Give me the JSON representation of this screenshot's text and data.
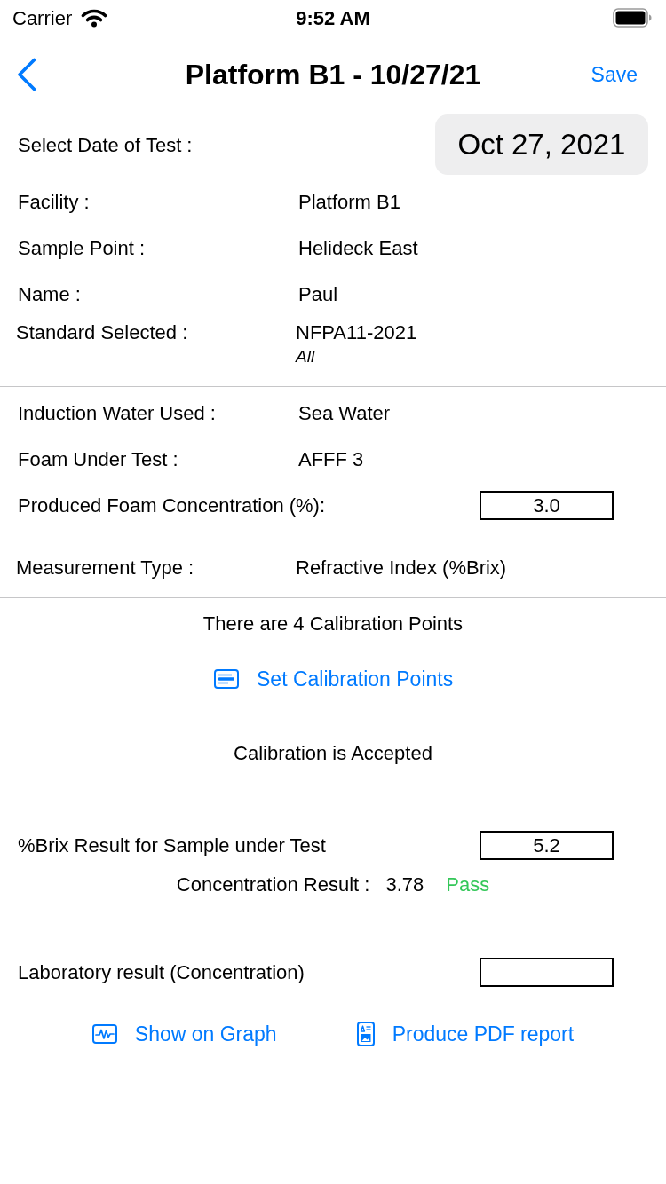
{
  "status_bar": {
    "carrier": "Carrier",
    "time": "9:52 AM"
  },
  "nav": {
    "title": "Platform B1 - 10/27/21",
    "save": "Save"
  },
  "date": {
    "label": "Select Date of Test :",
    "value": "Oct 27, 2021"
  },
  "info_rows": [
    {
      "label": "Facility :",
      "value": "Platform B1"
    },
    {
      "label": "Sample Point :",
      "value": "Helideck East"
    },
    {
      "label": "Name :",
      "value": "Paul"
    }
  ],
  "standard": {
    "label": "Standard Selected :",
    "value": "NFPA11-2021",
    "subvalue": "All"
  },
  "test_rows": [
    {
      "kind": "text",
      "label": "Induction Water Used :",
      "value": "Sea Water"
    },
    {
      "kind": "text",
      "label": "Foam Under Test :",
      "value": "AFFF 3"
    },
    {
      "kind": "input",
      "label": "Produced Foam Concentration (%):",
      "value": "3.0"
    }
  ],
  "measurement": {
    "label": "Measurement Type :",
    "value": "Refractive Index (%Brix)"
  },
  "calibration": {
    "points_text": "There are 4 Calibration Points",
    "button": "Set Calibration Points",
    "status": "Calibration is Accepted"
  },
  "brix": {
    "label": "%Brix Result for Sample under Test",
    "value": "5.2"
  },
  "concentration": {
    "label": "Concentration Result :",
    "value": "3.78",
    "verdict": {
      "kind": "pass",
      "text": "Pass"
    }
  },
  "lab": {
    "label": "Laboratory result (Concentration)"
  },
  "actions": [
    {
      "kind": "graph",
      "label": "Show on Graph"
    },
    {
      "kind": "pdf",
      "label": "Produce PDF report"
    }
  ]
}
